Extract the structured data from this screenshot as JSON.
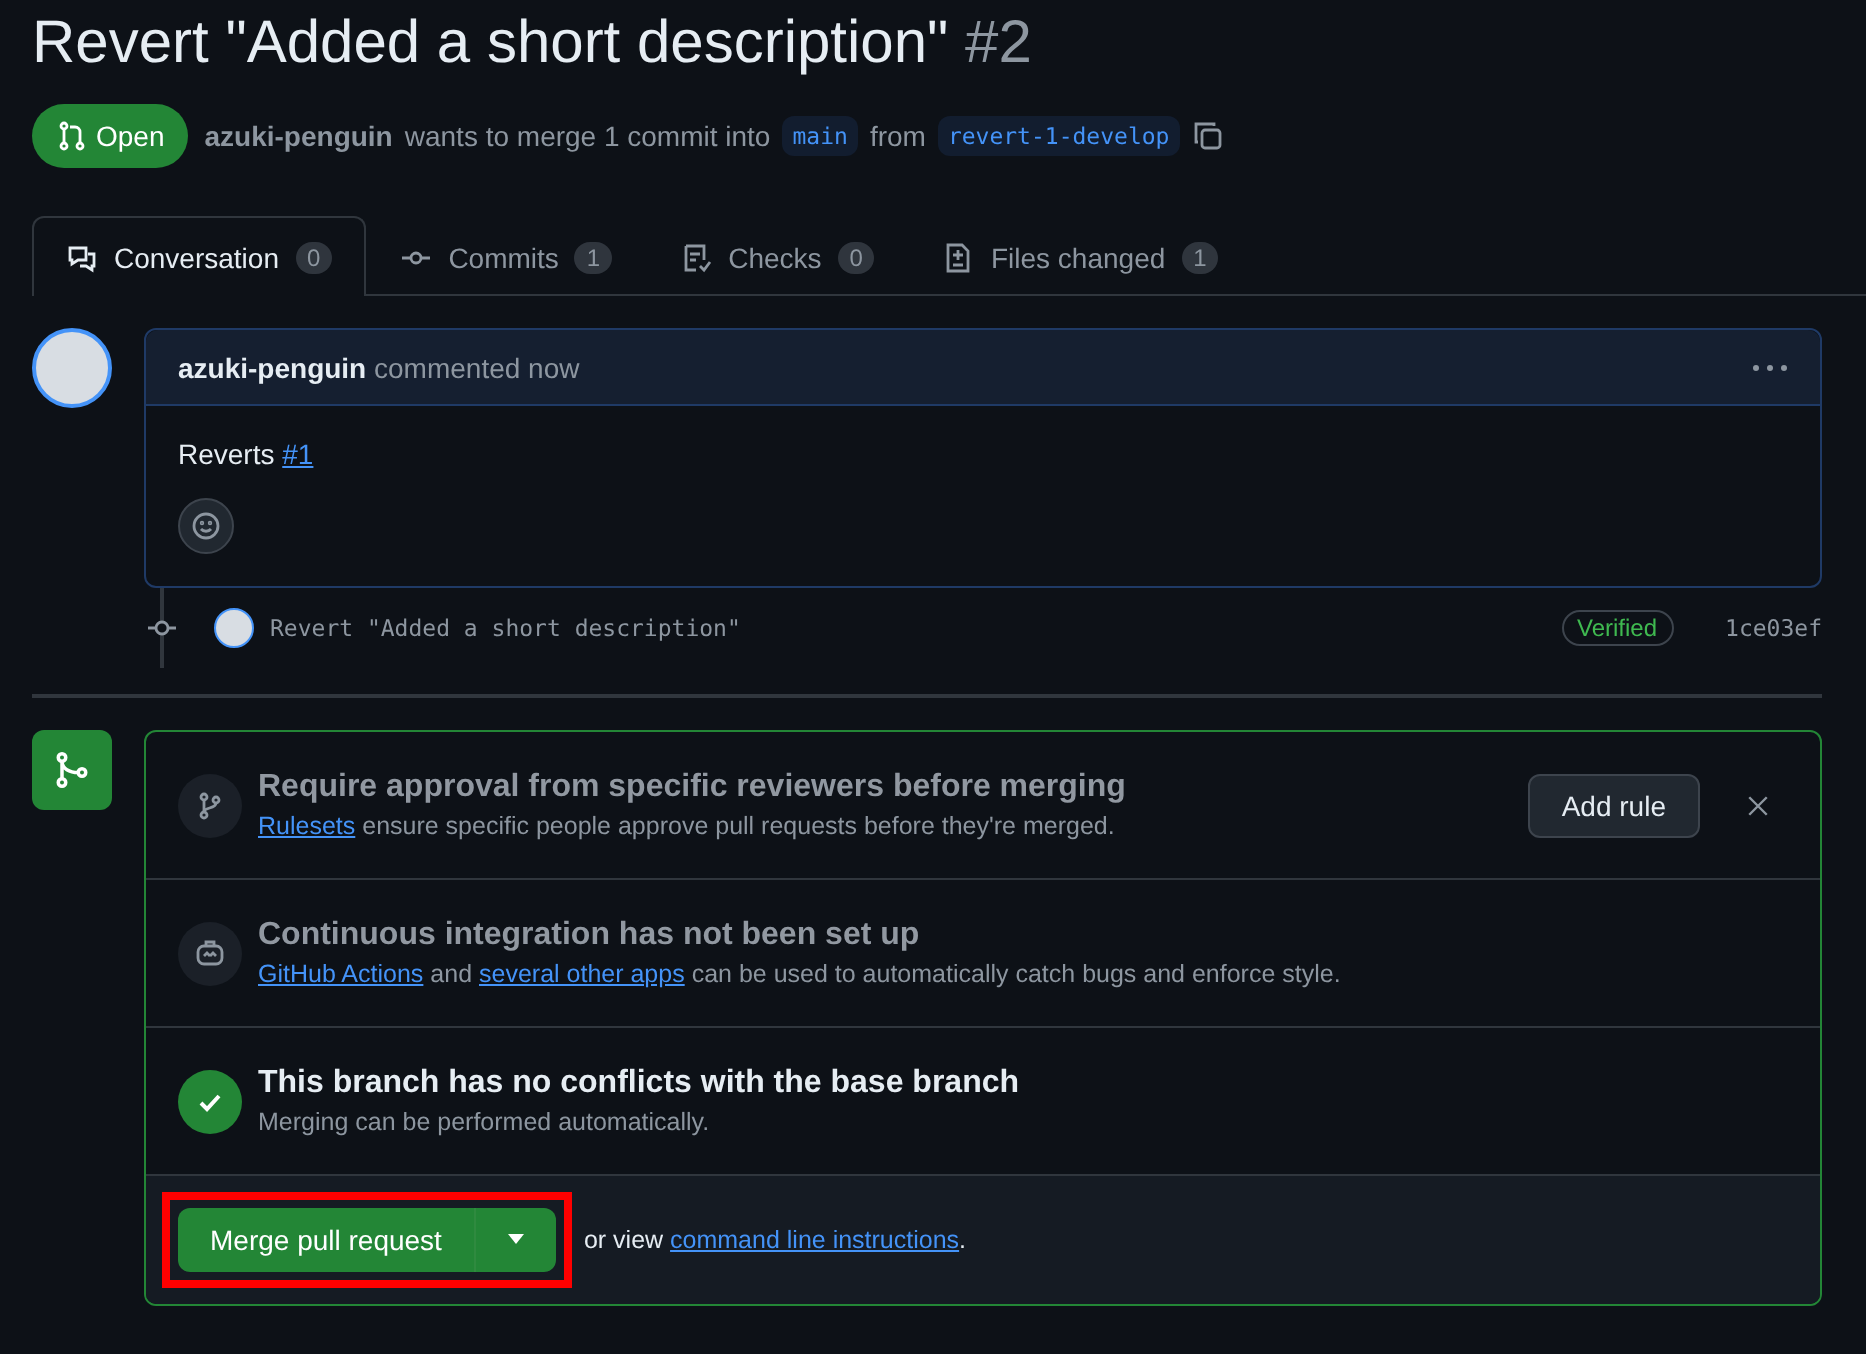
{
  "title": {
    "text": "Revert \"Added a short description\"",
    "number": "#2"
  },
  "header": {
    "state": {
      "label": "Open",
      "kind": "open"
    },
    "author": "azuki-penguin",
    "text_before": "wants to merge 1 commit into",
    "base": "main",
    "text_between": "from",
    "head": "revert-1-develop"
  },
  "tabs": [
    {
      "label": "Conversation",
      "count": "0",
      "selected": true,
      "kind": "conversation"
    },
    {
      "label": "Commits",
      "count": "1",
      "selected": false,
      "kind": "commits"
    },
    {
      "label": "Checks",
      "count": "0",
      "selected": false,
      "kind": "checks"
    },
    {
      "label": "Files changed",
      "count": "1",
      "selected": false,
      "kind": "files"
    }
  ],
  "comment": {
    "author": "azuki-penguin",
    "action": "commented now",
    "body_text": "Reverts",
    "body_link": "#1"
  },
  "commit": {
    "message": "Revert \"Added a short description\"",
    "badge": "Verified",
    "sha": "1ce03ef"
  },
  "merge_box": {
    "sections": [
      {
        "kind": "notice",
        "title": "Require approval from specific reviewers before merging",
        "segments": [
          {
            "text": "Rulesets",
            "link": true
          },
          {
            "text": " ensure specific people approve pull requests before they're merged.",
            "link": false
          }
        ],
        "action": "Add rule",
        "dismissible": true
      },
      {
        "kind": "notice",
        "title": "Continuous integration has not been set up",
        "segments": [
          {
            "text": "GitHub Actions",
            "link": true
          },
          {
            "text": " and ",
            "link": false
          },
          {
            "text": "several other apps",
            "link": true
          },
          {
            "text": " can be used to automatically catch bugs and enforce style.",
            "link": false
          }
        ],
        "dismissible": false
      },
      {
        "kind": "status",
        "title": "This branch has no conflicts with the base branch",
        "subtitle": "Merging can be performed automatically."
      }
    ],
    "footer": {
      "button": "Merge pull request",
      "highlighted": true,
      "text_before": "or view",
      "link": "command line instructions",
      "text_after": "."
    }
  }
}
